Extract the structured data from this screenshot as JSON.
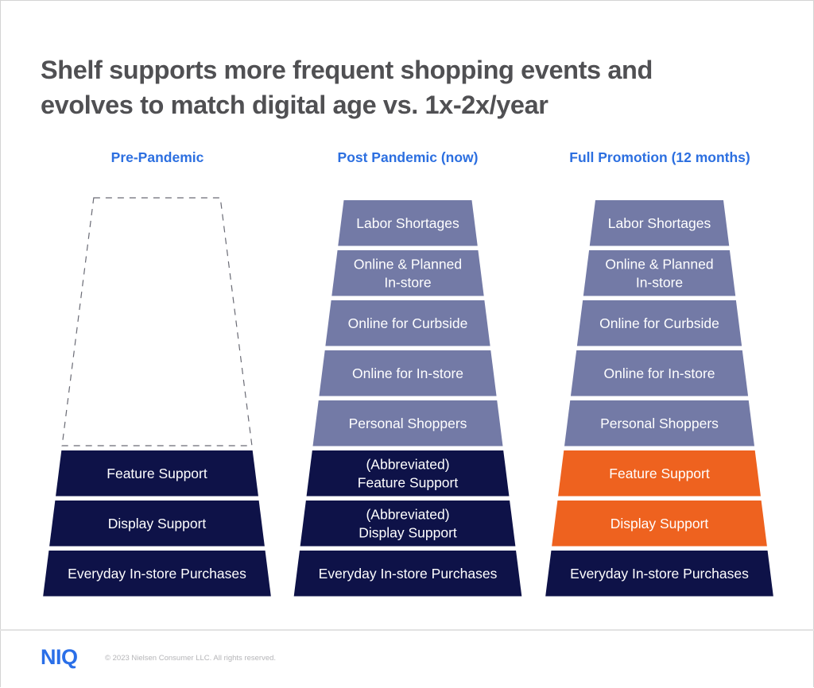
{
  "title": "Shelf supports more frequent shopping events and evolves to match digital age vs. 1x-2x/year",
  "title_lines": [
    "Shelf supports more frequent shopping events and",
    "evolves to match digital age vs. 1x-2x/year"
  ],
  "colors": {
    "header_blue": "#2c6fe0",
    "navy": "#0e1248",
    "lavender": "#737aa6",
    "orange": "#ee621f",
    "title_gray": "#505053",
    "dashed": "#6a6b75"
  },
  "columns": [
    {
      "header": "Pre-Pandemic",
      "placeholder": "empty-dashed-area",
      "layers": [
        {
          "label": [
            "Feature Support"
          ],
          "color": "navy"
        },
        {
          "label": [
            "Display Support"
          ],
          "color": "navy"
        },
        {
          "label": [
            "Everyday In-store Purchases"
          ],
          "color": "navy"
        }
      ]
    },
    {
      "header": "Post Pandemic (now)",
      "layers": [
        {
          "label": [
            "Labor Shortages"
          ],
          "color": "lavender"
        },
        {
          "label": [
            "Online & Planned",
            "In-store"
          ],
          "color": "lavender"
        },
        {
          "label": [
            "Online for Curbside"
          ],
          "color": "lavender"
        },
        {
          "label": [
            "Online for In-store"
          ],
          "color": "lavender"
        },
        {
          "label": [
            "Personal Shoppers"
          ],
          "color": "lavender"
        },
        {
          "label": [
            "(Abbreviated)",
            "Feature Support"
          ],
          "color": "navy"
        },
        {
          "label": [
            "(Abbreviated)",
            "Display Support"
          ],
          "color": "navy"
        },
        {
          "label": [
            "Everyday In-store Purchases"
          ],
          "color": "navy"
        }
      ]
    },
    {
      "header": "Full Promotion (12 months)",
      "layers": [
        {
          "label": [
            "Labor Shortages"
          ],
          "color": "lavender"
        },
        {
          "label": [
            "Online & Planned",
            "In-store"
          ],
          "color": "lavender"
        },
        {
          "label": [
            "Online for Curbside"
          ],
          "color": "lavender"
        },
        {
          "label": [
            "Online for In-store"
          ],
          "color": "lavender"
        },
        {
          "label": [
            "Personal Shoppers"
          ],
          "color": "lavender"
        },
        {
          "label": [
            "Feature Support"
          ],
          "color": "orange"
        },
        {
          "label": [
            "Display Support"
          ],
          "color": "orange"
        },
        {
          "label": [
            "Everyday In-store Purchases"
          ],
          "color": "navy"
        }
      ]
    }
  ],
  "footer": {
    "logo": "NIQ",
    "copyright": "© 2023 Nielsen Consumer LLC. All rights reserved."
  }
}
